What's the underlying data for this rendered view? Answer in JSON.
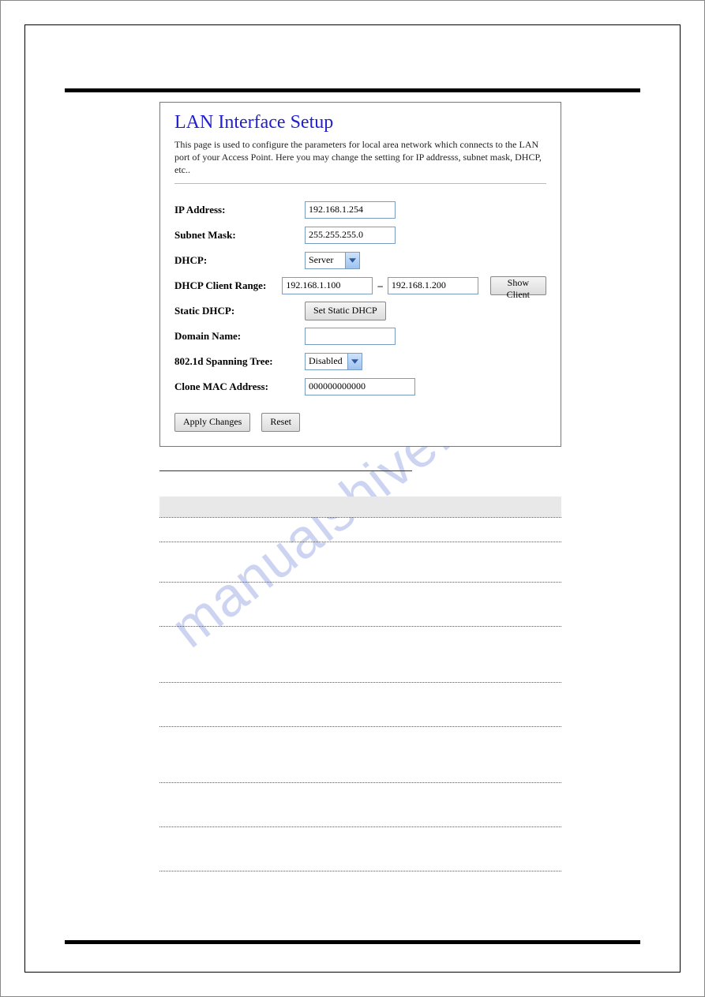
{
  "watermark": "manualshive.com",
  "panel": {
    "title": "LAN Interface Setup",
    "description": "This page is used to configure the parameters for local area network which connects to the LAN port of your Access Point. Here you may change the setting for IP addresss, subnet mask, DHCP, etc..",
    "labels": {
      "ip": "IP Address:",
      "subnet": "Subnet Mask:",
      "dhcp": "DHCP:",
      "dhcp_range": "DHCP Client Range:",
      "static_dhcp": "Static DHCP:",
      "domain": "Domain Name:",
      "spanning": "802.1d Spanning Tree:",
      "clone_mac": "Clone MAC Address:"
    },
    "values": {
      "ip": "192.168.1.254",
      "subnet": "255.255.255.0",
      "dhcp": "Server",
      "dhcp_range_start": "192.168.1.100",
      "dhcp_range_sep": "–",
      "dhcp_range_end": "192.168.1.200",
      "domain": "",
      "spanning": "Disabled",
      "clone_mac": "000000000000"
    },
    "buttons": {
      "show_client": "Show Client",
      "set_static": "Set Static DHCP",
      "apply": "Apply Changes",
      "reset": "Reset"
    }
  }
}
